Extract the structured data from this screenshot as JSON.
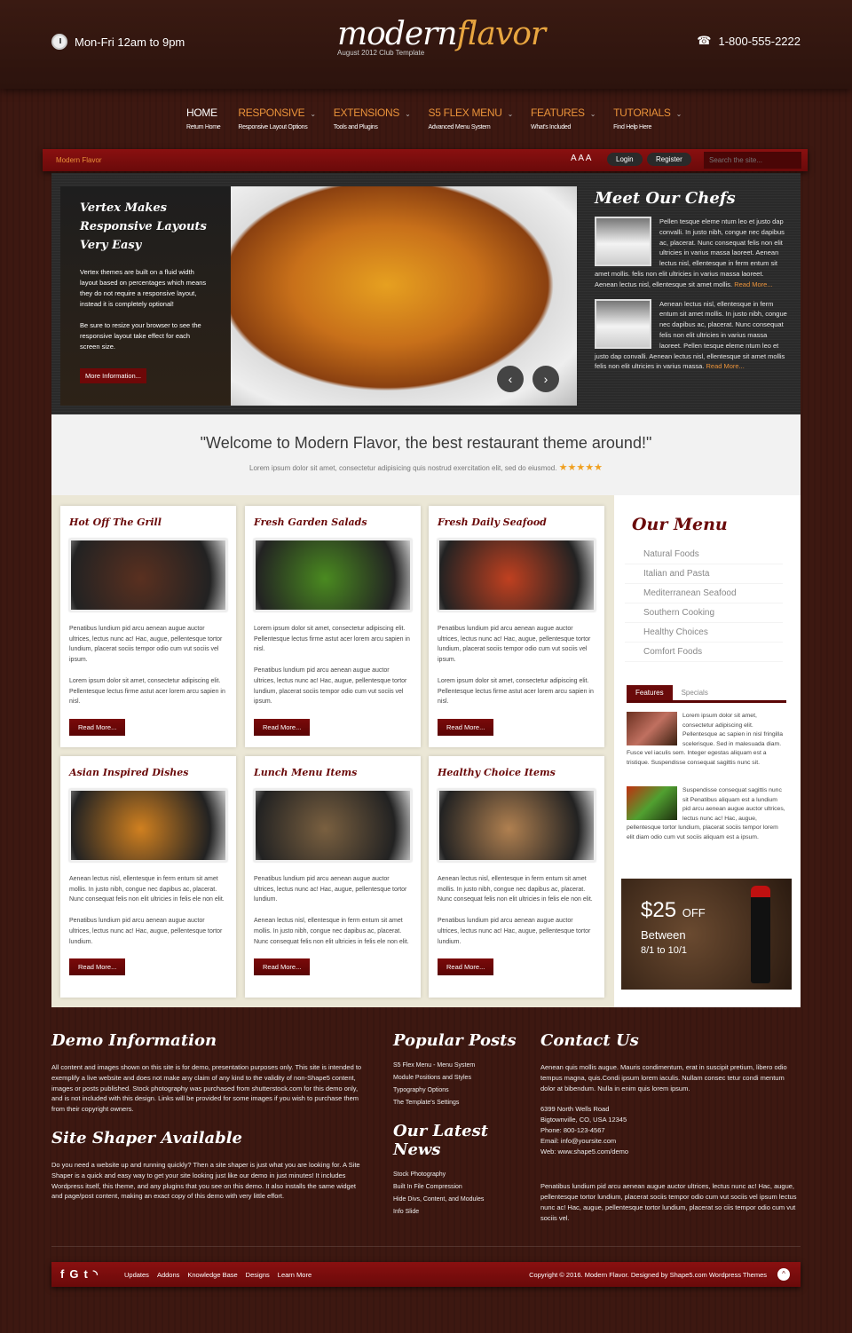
{
  "header": {
    "hours": "Mon-Fri 12am to 9pm",
    "phone": "1-800-555-2222",
    "logo_a": "modern",
    "logo_b": "flavor",
    "tagline": "August 2012 Club Template"
  },
  "nav": [
    {
      "label": "HOME",
      "sub": "Return Home"
    },
    {
      "label": "RESPONSIVE",
      "sub": "Responsive Layout Options"
    },
    {
      "label": "EXTENSIONS",
      "sub": "Tools and Plugins"
    },
    {
      "label": "S5 FLEX MENU",
      "sub": "Advanced Menu System"
    },
    {
      "label": "FEATURES",
      "sub": "What's Included"
    },
    {
      "label": "TUTORIALS",
      "sub": "Find Help Here"
    }
  ],
  "bar": {
    "breadcrumb": "Modern Flavor",
    "font_sizes": "A A A",
    "login": "Login",
    "register": "Register",
    "search_placeholder": "Search the site..."
  },
  "slider": {
    "title": "Vertex Makes Responsive Layouts Very Easy",
    "p1": "Vertex themes are built on a fluid width layout based on percentages which means they do not require a responsive layout, instead it is completely optional!",
    "p2": "Be sure to resize your browser to see the responsive layout take effect for each screen size.",
    "button": "More Information...",
    "prev": "‹",
    "next": "›"
  },
  "chefs": {
    "title": "Meet Our Chefs",
    "items": [
      {
        "text": "Pellen tesque eleme ntum leo et justo dap convalli. In justo nibh, congue nec dapibus ac, placerat. Nunc consequat felis non elit ultricies in varius massa laoreet. Aenean lectus nisl, ellentesque in ferm entum sit amet mollis. felis non elit ultricies in varius massa laoreet. Aenean lectus nisl, ellentesque sit amet mollis.",
        "more": "Read More..."
      },
      {
        "text": "Aenean lectus nisl, ellentesque in ferm entum sit amet mollis. In justo nibh, congue nec dapibus ac, placerat. Nunc consequat felis non elit ultricies in varius massa laoreet. Pellen tesque eleme ntum leo et justo dap convalli. Aenean lectus nisl, ellentesque sit amet mollis felis non elit ultricies in varius massa.",
        "more": "Read More..."
      }
    ]
  },
  "welcome": {
    "headline": "\"Welcome to Modern Flavor, the best restaurant theme around!\"",
    "sub": "Lorem ipsum dolor sit amet, consectetur adipisicing quis nostrud exercitation elit, sed do eiusmod.",
    "stars": "★★★★★",
    "rating": 5
  },
  "cards": [
    {
      "title": "Hot Off The Grill",
      "p1": "Penatibus lundium pid arcu aenean augue auctor ultrices, lectus nunc ac! Hac, augue, pellentesque tortor lundium, placerat sociis tempor odio cum vut sociis vel ipsum.",
      "p2": "Lorem ipsum dolor sit amet, consectetur adipiscing elit. Pellentesque lectus firme astut acer lorem arcu sapien in nisl.",
      "button": "Read More...",
      "color": "#5a3020"
    },
    {
      "title": "Fresh Garden Salads",
      "p1": "Lorem ipsum dolor sit amet, consectetur adipiscing elit. Pellentesque lectus firme astut acer lorem arcu sapien in nisl.",
      "p2": "Penatibus lundium pid arcu aenean augue auctor ultrices, lectus nunc ac! Hac, augue, pellentesque tortor lundium, placerat sociis tempor odio cum vut sociis vel ipsum.",
      "button": "Read More...",
      "color": "#4a8a20"
    },
    {
      "title": "Fresh Daily Seafood",
      "p1": "Penatibus lundium pid arcu aenean augue auctor ultrices, lectus nunc ac! Hac, augue, pellentesque tortor lundium, placerat sociis tempor odio cum vut sociis vel ipsum.",
      "p2": "Lorem ipsum dolor sit amet, consectetur adipiscing elit. Pellentesque lectus firme astut acer lorem arcu sapien in nisl.",
      "button": "Read More...",
      "color": "#c04020"
    },
    {
      "title": "Asian Inspired Dishes",
      "p1": "Aenean lectus nisl, ellentesque in ferm entum sit amet mollis. In justo nibh, congue nec dapibus ac, placerat. Nunc consequat felis non elit ultricies in felis ele non elit.",
      "p2": "Penatibus lundium pid arcu aenean augue auctor ultrices, lectus nunc ac! Hac, augue, pellentesque tortor lundium.",
      "button": "Read More...",
      "color": "#d08020"
    },
    {
      "title": "Lunch Menu Items",
      "p1": "Penatibus lundium pid arcu aenean augue auctor ultrices, lectus nunc ac! Hac, augue, pellentesque tortor lundium.",
      "p2": "Aenean lectus nisl, ellentesque in ferm entum sit amet mollis. In justo nibh, congue nec dapibus ac, placerat. Nunc consequat felis non elit ultricies in felis ele non elit.",
      "button": "Read More...",
      "color": "#7a6040"
    },
    {
      "title": "Healthy Choice Items",
      "p1": "Aenean lectus nisl, ellentesque in ferm entum sit amet mollis. In justo nibh, congue nec dapibus ac, placerat. Nunc consequat felis non elit ultricies in felis ele non elit.",
      "p2": "Penatibus lundium pid arcu aenean augue auctor ultrices, lectus nunc ac! Hac, augue, pellentesque tortor lundium.",
      "button": "Read More...",
      "color": "#b08050"
    }
  ],
  "sidebar": {
    "title": "Our Menu",
    "menu": [
      "Natural Foods",
      "Italian and Pasta",
      "Mediterranean Seafood",
      "Southern Cooking",
      "Healthy Choices",
      "Comfort Foods"
    ],
    "tabs": [
      "Features",
      "Specials"
    ],
    "features": [
      "Lorem ipsum dolor sit amet, consectetur adipiscing elit. Pellentesque ac sapien in nisl fringilla scelerisque. Sed in malesuada diam. Fusce vel iaculis sem. Integer egestas aliquam est a tristique. Suspendisse consequat sagittis nunc sit.",
      "Suspendisse consequat sagittis nunc sit Penatibus aliquam est a lundium pid arcu aenean augue auctor ultrices, lectus nunc ac! Hac, augue, pellentesque tortor lundium, placerat sociis tempor lorem elit diam odio cum vut sociis aliquam est a ipsum."
    ],
    "promo": {
      "amount": "$25",
      "off": "OFF",
      "between": "Between",
      "dates": "8/1 to 10/1"
    }
  },
  "footer": {
    "demo_title": "Demo Information",
    "demo_text": "All content and images shown on this site is for demo, presentation purposes only. This site is intended to exemplify a live website and does not make any claim of any kind to the validity of non-Shape5 content, images or posts published. Stock photography was purchased from shutterstock.com for this demo only, and is not included with this design. Links will be provided for some images if you wish to purchase them from their copyright owners.",
    "shaper_title": "Site Shaper Available",
    "shaper_text": "Do you need a website up and running quickly? Then a site shaper is just what you are looking for. A Site Shaper is a quick and easy way to get your site looking just like our demo in just minutes! It includes Wordpress itself, this theme, and any plugins that you see on this demo. It also installs the same widget and page/post content, making an exact copy of this demo with very little effort.",
    "popular_title": "Popular Posts",
    "popular": [
      "S5 Flex Menu - Menu System",
      "Module Positions and Styles",
      "Typography Options",
      "The Template's Settings"
    ],
    "news_title": "Our Latest News",
    "news": [
      "Stock Photography",
      "Built In File Compression",
      "Hide Divs, Content, and Modules",
      "Info Slide"
    ],
    "contact_title": "Contact Us",
    "contact_text": "Aenean quis mollis augue. Mauris condimentum, erat in suscipit pretium, libero odio tempus magna, quis.Condi ipsum lorem iaculis. Nullam consec tetur condi mentum dolor at bibendum. Nulla in enim quis lorem ipsum.",
    "address": [
      "6399 North Wells Road",
      "Bigtownville, CO, USA 12345",
      "Phone: 800-123-4567",
      "Email: info@yoursite.com",
      "Web: www.shape5.com/demo"
    ],
    "contact_text2": "Penatibus lundium pid arcu aenean augue auctor ultrices, lectus nunc ac! Hac, augue, pellentesque tortor lundium, placerat sociis tempor odio cum vut sociis vel ipsum lectus nunc ac! Hac, augue, pellentesque tortor lundium, placerat so ciis tempor odio cum vut sociis vel."
  },
  "bottombar": {
    "social": [
      "f",
      "G",
      "t",
      "rss"
    ],
    "links": [
      "Updates",
      "Addons",
      "Knowledge Base",
      "Designs",
      "Learn More"
    ],
    "copyright": "Copyright © 2016. Modern Flavor. Designed by Shape5.com Wordpress Themes",
    "top": "^"
  },
  "colors": {
    "accent": "#6a0a0a",
    "orange": "#e9923a",
    "background": "#3d1811"
  }
}
